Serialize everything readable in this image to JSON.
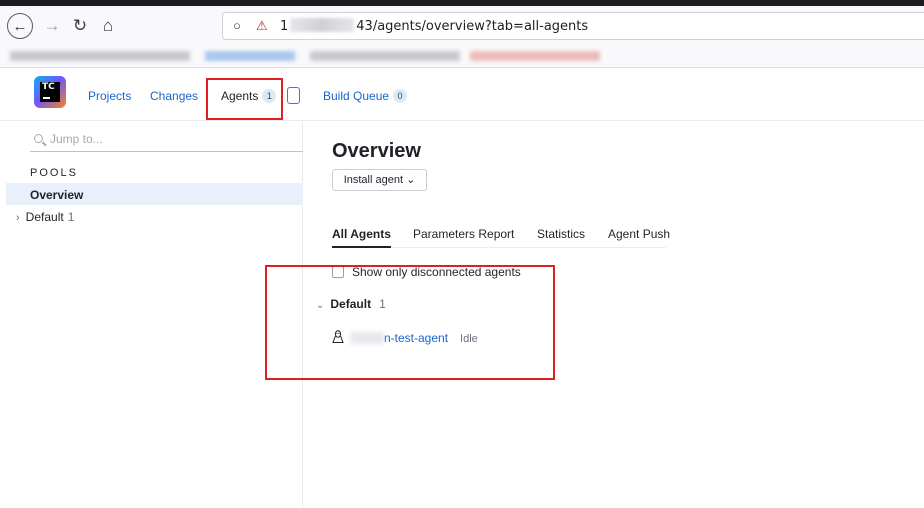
{
  "browser": {
    "back_icon": "back-arrow-icon",
    "forward_icon": "forward-arrow-icon",
    "reload_icon": "reload-icon",
    "home_icon": "home-icon",
    "url_prefix": "1",
    "url_suffix": "43/agents/overview?tab=all-agents"
  },
  "header": {
    "logo_text": "TC",
    "nav": {
      "projects": "Projects",
      "changes": "Changes",
      "agents": "Agents",
      "agents_count": "1",
      "build_queue": "Build Queue",
      "build_queue_count": "0"
    }
  },
  "sidebar": {
    "search_placeholder": "Jump to...",
    "pools_title": "POOLS",
    "overview": "Overview",
    "default_label": "Default",
    "default_count": "1"
  },
  "main": {
    "title": "Overview",
    "install_button": "Install agent ⌄",
    "tabs": [
      "All Agents",
      "Parameters Report",
      "Statistics",
      "Agent Push"
    ],
    "checkbox_label": "Show only disconnected agents",
    "group_label": "Default",
    "group_count": "1",
    "agent": {
      "name": "n-test-agent",
      "status": "Idle",
      "os_icon": "linux-icon"
    }
  },
  "colors": {
    "link": "#1a66cc",
    "highlight_box": "#e02020",
    "selected_bg": "#e8f1fb"
  }
}
